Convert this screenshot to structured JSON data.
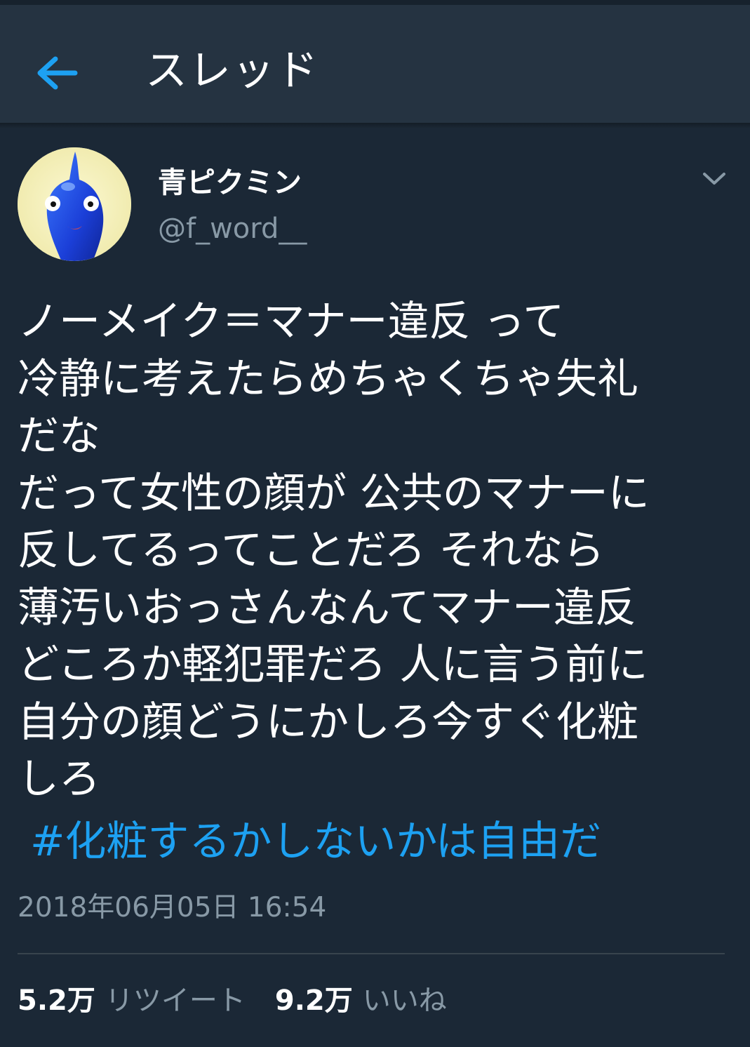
{
  "header": {
    "title": "スレッド",
    "back_icon": "arrow-left-icon",
    "accent_color": "#1da1f2"
  },
  "tweet": {
    "display_name": "青ピクミン",
    "handle": "@f_word__",
    "menu_icon": "chevron-down-icon",
    "text_lines": [
      "ノーメイク＝マナー違反 って",
      "冷静に考えたらめちゃくちゃ失礼",
      "だな",
      "だって女性の顔が 公共のマナーに",
      "反してるってことだろ それなら",
      "薄汚いおっさんなんてマナー違反",
      "どころか軽犯罪だろ 人に言う前に",
      "自分の顔どうにかしろ今すぐ化粧",
      "しろ"
    ],
    "hashtag": "#化粧するかしないかは自由だ",
    "timestamp": "2018年06月05日 16:54",
    "stats": {
      "retweets_count": "5.2万",
      "retweets_label": "リツイート",
      "likes_count": "9.2万",
      "likes_label": "いいね"
    }
  },
  "colors": {
    "background": "#1b2836",
    "header_background": "#253341",
    "secondary_text": "#8899a6",
    "hashtag": "#1da1f2"
  }
}
